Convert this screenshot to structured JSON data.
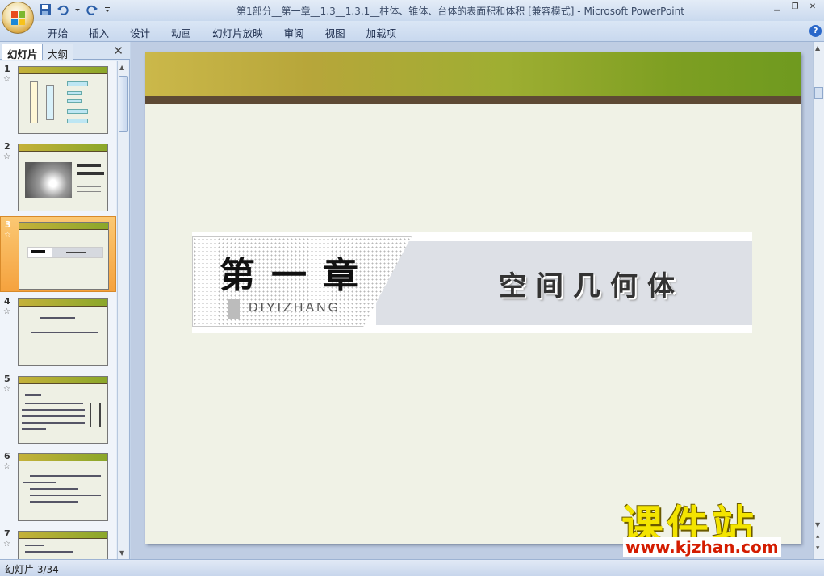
{
  "window": {
    "title": "第1部分__第一章__1.3__1.3.1__柱体、锥体、台体的表面积和体积 [兼容模式] - Microsoft PowerPoint"
  },
  "ribbon": {
    "tabs": [
      "开始",
      "插入",
      "设计",
      "动画",
      "幻灯片放映",
      "审阅",
      "视图",
      "加载项"
    ]
  },
  "leftpanel": {
    "tab_slides": "幻灯片",
    "tab_outline": "大纲",
    "slides": [
      {
        "num": "1"
      },
      {
        "num": "2"
      },
      {
        "num": "3"
      },
      {
        "num": "4"
      },
      {
        "num": "5"
      },
      {
        "num": "6"
      },
      {
        "num": "7"
      }
    ]
  },
  "slide": {
    "chapter_title": "第一章",
    "chapter_pinyin": "DIYIZHANG",
    "topic_title": "空间几何体"
  },
  "status": {
    "slide_info": "幻灯片 3/34"
  },
  "watermark": {
    "brand": "课件站",
    "url": "www.kjzhan.com"
  },
  "colors": {
    "accent_green": "#7e9f22",
    "selection_orange": "#f5a23e",
    "ribbon_blue": "#c8d8ee"
  }
}
